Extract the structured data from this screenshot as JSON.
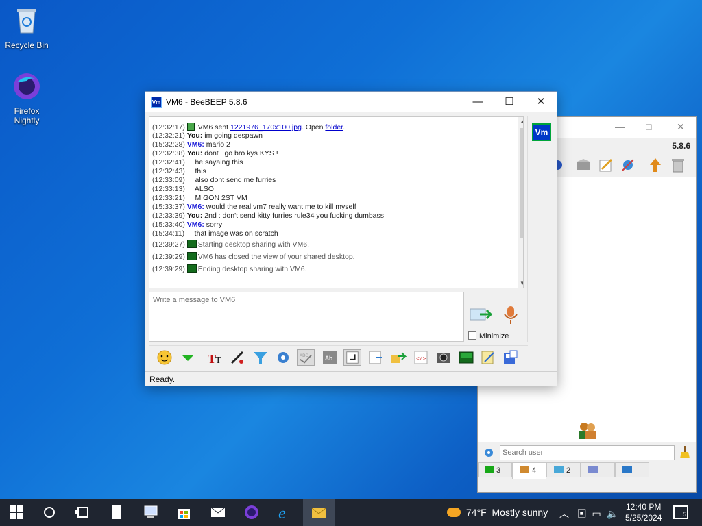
{
  "desktop": {
    "icons": [
      {
        "label": "Recycle Bin"
      },
      {
        "label": "Firefox Nightly"
      }
    ]
  },
  "main_window": {
    "version": "5.8.6",
    "search_placeholder": "Search user",
    "tabs": [
      {
        "label": "3"
      },
      {
        "label": "4"
      },
      {
        "label": "2"
      },
      {
        "label": ""
      },
      {
        "label": ""
      }
    ]
  },
  "chat_window": {
    "title": "VM6 - BeeBEEP 5.8.6",
    "avatar_text": "Vm",
    "input_placeholder": "Write a message to VM6",
    "minimize_label": "Minimize",
    "status": "Ready.",
    "messages": [
      {
        "ts": "(12:32:17)",
        "who": "",
        "text": " VM6 sent ",
        "link": "1221976_170x100.jpg",
        "after": ". Open ",
        "link2": "folder",
        "end": "."
      },
      {
        "ts": "(12:32:21)",
        "who": "You:",
        "text": " im going despawn"
      },
      {
        "ts": "(15:32:28)",
        "who": "VM6:",
        "text": " mario 2"
      },
      {
        "ts": "(12:32:38)",
        "who": "You:",
        "text": " dont   go bro kys KYS !"
      },
      {
        "ts": "(12:32:41)",
        "who": "",
        "text": "    he sayaing this"
      },
      {
        "ts": "(12:32:43)",
        "who": "",
        "text": "    this"
      },
      {
        "ts": "(12:33:09)",
        "who": "",
        "text": "    also dont send me furries"
      },
      {
        "ts": "(12:33:13)",
        "who": "",
        "text": "    ALSO"
      },
      {
        "ts": "(12:33:21)",
        "who": "",
        "text": "    M GON 2ST VM"
      },
      {
        "ts": "(15:33:37)",
        "who": "VM6:",
        "text": " would the real vm7 really want me to kill myself"
      },
      {
        "ts": "(12:33:39)",
        "who": "You:",
        "text": " 2nd : don't send kitty furries rule34 you fucking dumbass"
      },
      {
        "ts": "(15:33:40)",
        "who": "VM6:",
        "text": " sorry"
      },
      {
        "ts": "(15:34:11)",
        "who": "",
        "text": "    that image was on scratch"
      },
      {
        "ts": "(12:39:27)",
        "who": "",
        "text": "Starting desktop sharing with VM6.",
        "system": true
      },
      {
        "ts": "(12:39:29)",
        "who": "",
        "text": "VM6 has closed the view of your shared desktop.",
        "system": true
      },
      {
        "ts": "(12:39:29)",
        "who": "",
        "text": "Ending desktop sharing with VM6.",
        "system": true
      }
    ]
  },
  "taskbar": {
    "weather_temp": "74°F",
    "weather_text": "Mostly sunny",
    "time": "12:40 PM",
    "date": "5/25/2024",
    "notifications": "5"
  },
  "colors": {
    "accent": "#0029a8",
    "you": "#111111",
    "vm6": "#1a1ad8"
  }
}
